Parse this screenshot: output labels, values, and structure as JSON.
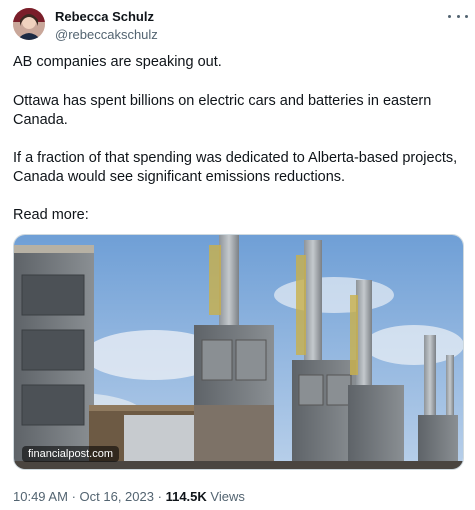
{
  "author": {
    "name": "Rebecca Schulz",
    "handle": "@rebeccakschulz"
  },
  "tweet": {
    "paragraphs": [
      "AB companies are speaking out.",
      "Ottawa has spent billions on electric cars and batteries in eastern Canada.",
      "If a fraction of that spending was dedicated to Alberta-based projects, Canada would see significant emissions reductions.",
      "Read more:"
    ],
    "paragraph_lines": [
      [
        "AB companies are speaking out."
      ],
      [
        "Ottawa has spent billions on electric cars and batteries in eastern",
        "Canada."
      ],
      [
        "If a fraction of that spending was dedicated to Alberta-based projects,",
        "Canada would see significant emissions reductions."
      ],
      [
        "Read more:"
      ]
    ]
  },
  "media": {
    "source_label": "financialpost.com"
  },
  "meta": {
    "time": "10:49 AM",
    "separator": "·",
    "date": "Oct 16, 2023",
    "views_count": "114.5K",
    "views_label": "Views"
  },
  "icons": {
    "more": "more-options-icon"
  },
  "colors": {
    "text": "#0f1419",
    "secondary": "#536471",
    "border": "#cfd9de"
  }
}
